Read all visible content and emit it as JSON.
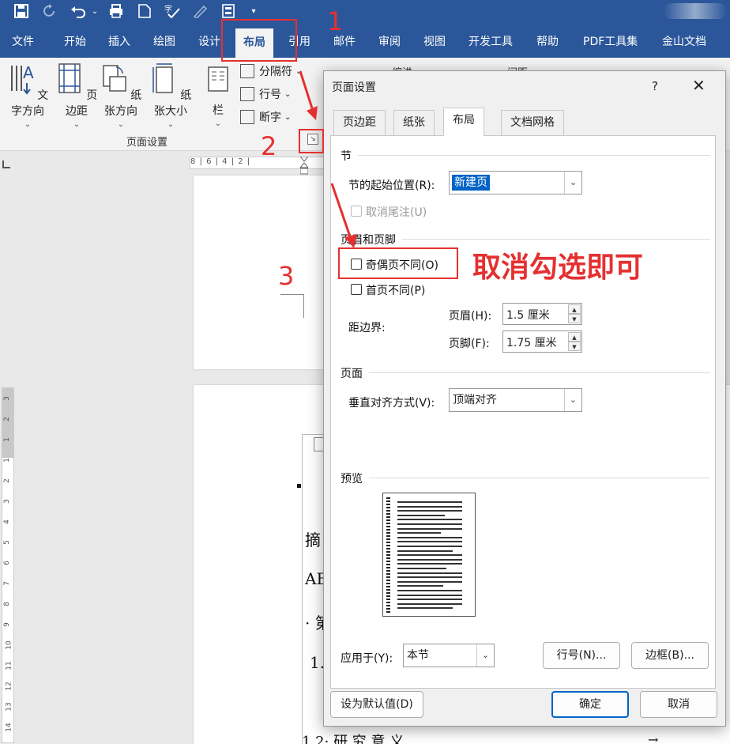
{
  "quick_access": {
    "save_icon": "save-icon",
    "redo_icon": "redo-icon",
    "undo_icon": "undo-icon",
    "print_icon": "print-icon",
    "new_icon": "new-doc-icon",
    "spell_icon": "spell-check-icon",
    "ink_icon": "ink-icon",
    "touch_icon": "touch-mode-icon",
    "more": "▾"
  },
  "ribbon_tabs": [
    "文件",
    "开始",
    "插入",
    "绘图",
    "设计",
    "布局",
    "引用",
    "邮件",
    "审阅",
    "视图",
    "开发工具",
    "帮助",
    "PDF工具集",
    "金山文档"
  ],
  "ribbon": {
    "buttons": [
      {
        "label": "文字方向",
        "chev": "⌄"
      },
      {
        "label": "页边距",
        "chev": "⌄"
      },
      {
        "label": "纸张方向",
        "chev": "⌄"
      },
      {
        "label": "纸张大小",
        "chev": "⌄"
      },
      {
        "label": "栏",
        "chev": "⌄"
      }
    ],
    "small": [
      {
        "label": "分隔符",
        "chev": "⌄"
      },
      {
        "label": "行号",
        "chev": "⌄"
      },
      {
        "label": "断字",
        "chev": "⌄"
      }
    ],
    "group_label": "页面设置",
    "launcher": "↘",
    "right_labels": [
      "缩进",
      "间距"
    ]
  },
  "ruler": {
    "h_ticks": "8 | 6 | 4 | 2 |",
    "v_ticks": [
      "3",
      "2",
      "1",
      "1",
      "2",
      "3",
      "4",
      "5",
      "6",
      "7",
      "8",
      "9",
      "10",
      "11",
      "12",
      "13",
      "14"
    ]
  },
  "document": {
    "lines": [
      "摘",
      "AB",
      "· 第",
      "1.",
      "1.2· 研 究 意 义"
    ],
    "arrow": "→"
  },
  "dialog": {
    "title": "页面设置",
    "help": "?",
    "close": "✕",
    "tabs": [
      {
        "label": "页边距",
        "active": false
      },
      {
        "label": "纸张",
        "active": false
      },
      {
        "label": "布局",
        "active": true
      },
      {
        "label": "文档网格",
        "active": false
      }
    ],
    "section_jie": "节",
    "section_start_label": "节的起始位置(R):",
    "section_start_value": "新建页",
    "suppress_endnotes_label": "取消尾注(U)",
    "section_header_footer": "页眉和页脚",
    "odd_even_label": "奇偶页不同(O)",
    "odd_even_checked": false,
    "first_page_label": "首页不同(P)",
    "first_page_checked": false,
    "from_edge_label": "距边界:",
    "header_label": "页眉(H):",
    "header_value": "1.5 厘米",
    "footer_label": "页脚(F):",
    "footer_value": "1.75 厘米",
    "section_page": "页面",
    "vertical_align_label": "垂直对齐方式(V):",
    "vertical_align_value": "顶端对齐",
    "section_preview": "预览",
    "apply_to_label": "应用于(Y):",
    "apply_to_value": "本节",
    "line_numbers_button": "行号(N)...",
    "borders_button": "边框(B)...",
    "set_default_button": "设为默认值(D)",
    "ok_button": "确定",
    "cancel_button": "取消"
  },
  "annotations": {
    "num1": "1",
    "num2": "2",
    "num3a": "3",
    "num3b": "3",
    "note": "取消勾选即可",
    "color": "#e53030"
  },
  "colors": {
    "brand": "#2b579a",
    "selection": "#0063c6"
  }
}
